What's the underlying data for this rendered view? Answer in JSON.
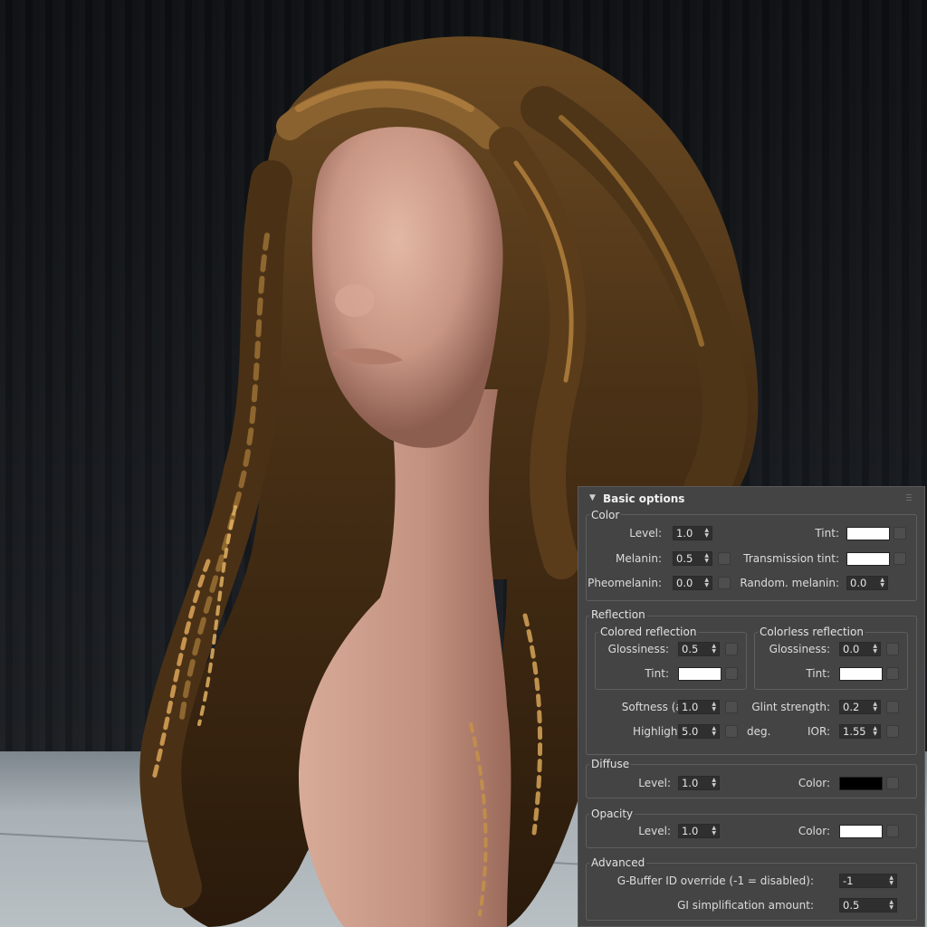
{
  "rollout": {
    "title": "Basic options",
    "collapse_icon": "triangle-down-icon",
    "grip_icon": "drag-grip-icon"
  },
  "color": {
    "group_label": "Color",
    "level_label": "Level:",
    "level_value": "1.0",
    "tint_label": "Tint:",
    "tint_color": "#ffffff",
    "melanin_label": "Melanin:",
    "melanin_value": "0.5",
    "transmission_tint_label": "Transmission tint:",
    "transmission_tint_color": "#ffffff",
    "pheomelanin_label": "Pheomelanin:",
    "pheomelanin_value": "0.0",
    "random_melanin_label": "Random. melanin:",
    "random_melanin_value": "0.0"
  },
  "reflection": {
    "group_label": "Reflection",
    "colored": {
      "group_label": "Colored reflection",
      "glossiness_label": "Glossiness:",
      "glossiness_value": "0.5",
      "tint_label": "Tint:",
      "tint_color": "#ffffff"
    },
    "colorless": {
      "group_label": "Colorless reflection",
      "glossiness_label": "Glossiness:",
      "glossiness_value": "0.0",
      "tint_label": "Tint:",
      "tint_color": "#ffffff"
    },
    "softness_label": "Softness (aniso):",
    "softness_value": "1.0",
    "glint_strength_label": "Glint strength:",
    "glint_strength_value": "0.2",
    "highlight_shift_label": "Highlight shift:",
    "highlight_shift_value": "5.0",
    "highlight_shift_unit": "deg.",
    "ior_label": "IOR:",
    "ior_value": "1.55"
  },
  "diffuse": {
    "group_label": "Diffuse",
    "level_label": "Level:",
    "level_value": "1.0",
    "color_label": "Color:",
    "color": "#000000"
  },
  "opacity": {
    "group_label": "Opacity",
    "level_label": "Level:",
    "level_value": "1.0",
    "color_label": "Color:",
    "color": "#ffffff"
  },
  "advanced": {
    "group_label": "Advanced",
    "gbuffer_label": "G-Buffer ID override (-1 = disabled):",
    "gbuffer_value": "-1",
    "gi_label": "GI simplification amount:",
    "gi_value": "0.5"
  },
  "spinner_icon": "spinner-arrows-icon"
}
